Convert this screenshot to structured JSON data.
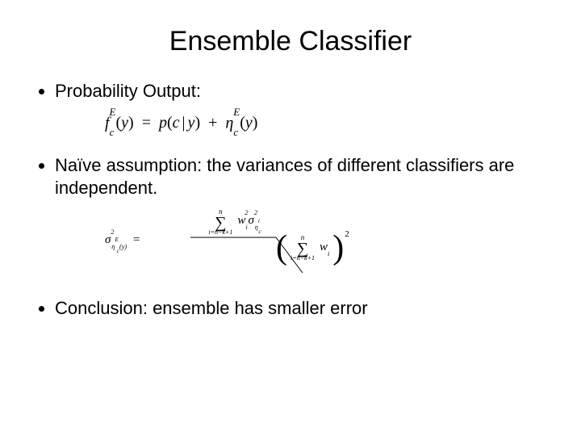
{
  "title": "Ensemble Classifier",
  "bullets": {
    "b1": "Probability Output:",
    "b2": "Naïve assumption: the variances of different classifiers are independent.",
    "b3": "Conclusion: ensemble has smaller error"
  },
  "eq1": {
    "f": "f",
    "sub_c": "c",
    "sup_E": "E",
    "y": "y",
    "eq": "=",
    "p": "p",
    "c": "c",
    "bar": "|",
    "plus": "+",
    "eta": "η"
  },
  "eq2": {
    "sigma": "σ",
    "two": "2",
    "eta": "η",
    "E": "E",
    "c": "c",
    "y": "y",
    "eq": "=",
    "sum": "∑",
    "top_n": "n",
    "bot": "i=n−k+1",
    "w": "w",
    "i": "i"
  }
}
